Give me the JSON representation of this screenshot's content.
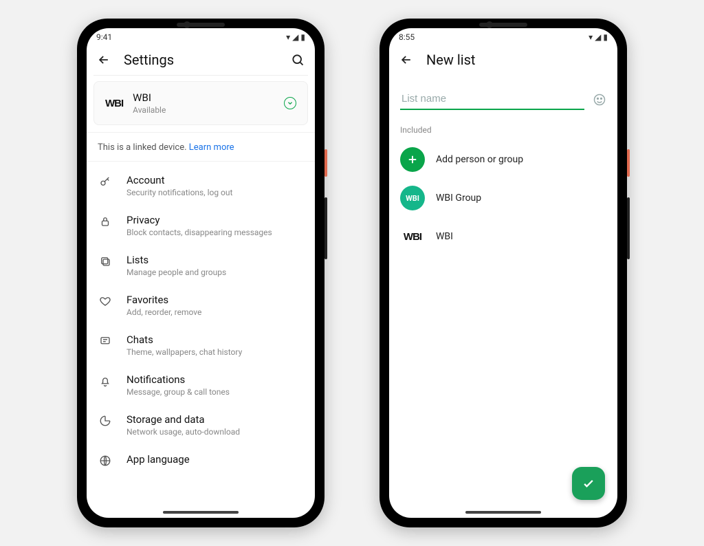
{
  "left": {
    "status_time": "9:41",
    "title": "Settings",
    "profile": {
      "logo": "WBI",
      "name": "WBI",
      "status": "Available"
    },
    "linked_device_text": "This is a linked device. ",
    "learn_more": "Learn more",
    "items": [
      {
        "icon": "key",
        "title": "Account",
        "sub": "Security notifications, log out"
      },
      {
        "icon": "lock",
        "title": "Privacy",
        "sub": "Block contacts, disappearing messages"
      },
      {
        "icon": "lists",
        "title": "Lists",
        "sub": "Manage people and groups"
      },
      {
        "icon": "heart",
        "title": "Favorites",
        "sub": "Add, reorder, remove"
      },
      {
        "icon": "chat",
        "title": "Chats",
        "sub": "Theme, wallpapers, chat history"
      },
      {
        "icon": "bell",
        "title": "Notifications",
        "sub": "Message, group & call tones"
      },
      {
        "icon": "storage",
        "title": "Storage and data",
        "sub": "Network usage, auto-download"
      },
      {
        "icon": "globe",
        "title": "App language",
        "sub": ""
      }
    ]
  },
  "right": {
    "status_time": "8:55",
    "title": "New list",
    "input_placeholder": "List name",
    "section_label": "Included",
    "add_label": "Add person or group",
    "items": [
      {
        "kind": "group",
        "logo": "WBI",
        "label": "WBI Group"
      },
      {
        "kind": "person",
        "logo": "WBI",
        "label": "WBI"
      }
    ]
  }
}
